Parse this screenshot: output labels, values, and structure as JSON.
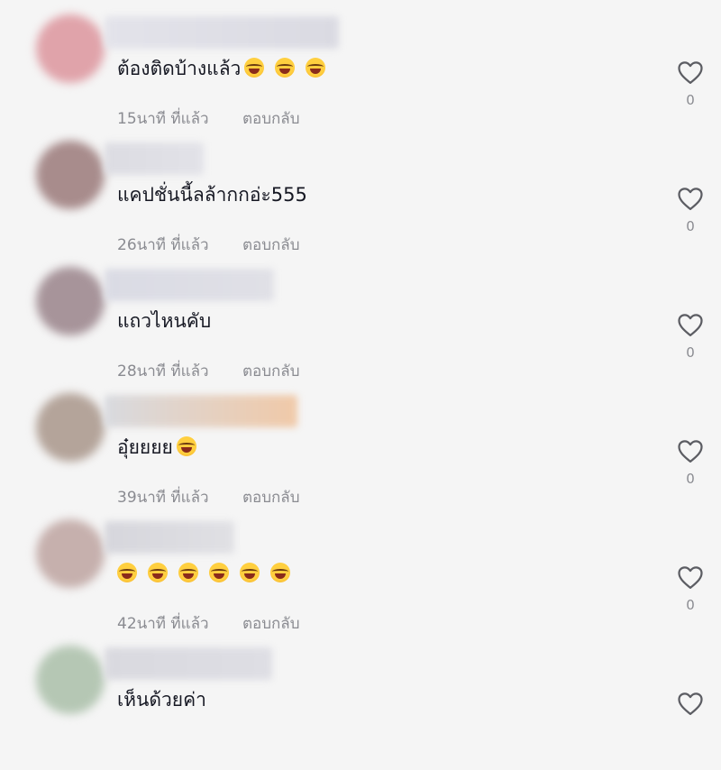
{
  "comments": [
    {
      "text": "ต้องติดบ้างแล้ว",
      "emoji_count": 3,
      "time": "15นาที ที่แล้ว",
      "reply_label": "ตอบกลับ",
      "likes": "0",
      "avatar_color": "#e0a3aa",
      "name_colors": [
        "#e3e3ea",
        "#dadae2"
      ]
    },
    {
      "text": "แคปชั่นนี้ลล้ากกอ่ะ555",
      "emoji_count": 0,
      "time": "26นาที ที่แล้ว",
      "reply_label": "ตอบกลับ",
      "likes": "0",
      "avatar_color": "#a88c8c",
      "name_colors": [
        "#dcdce2",
        "#e2e2e8"
      ]
    },
    {
      "text": "แถวไหนคับ",
      "emoji_count": 0,
      "time": "28นาที ที่แล้ว",
      "reply_label": "ตอบกลับ",
      "likes": "0",
      "avatar_color": "#a7949a",
      "name_colors": [
        "#dadbe4",
        "#e0e0e6"
      ]
    },
    {
      "text": "อุ๋ยยยย",
      "emoji_count": 1,
      "time": "39นาที ที่แล้ว",
      "reply_label": "ตอบกลับ",
      "likes": "0",
      "avatar_color": "#b4a49a",
      "name_colors": [
        "#d8dadf",
        "#f0c9a8"
      ]
    },
    {
      "text": "",
      "emoji_count": 6,
      "time": "42นาที ที่แล้ว",
      "reply_label": "ตอบกลับ",
      "likes": "0",
      "avatar_color": "#c6b0ad",
      "name_colors": [
        "#d6d6dc",
        "#e0e0e4"
      ]
    },
    {
      "text": "เห็นด้วยค่า",
      "emoji_count": 0,
      "time": "",
      "reply_label": "",
      "likes": "",
      "avatar_color": "#b5c7b4",
      "name_colors": [
        "#d9d9df",
        "#dedee4"
      ]
    }
  ]
}
